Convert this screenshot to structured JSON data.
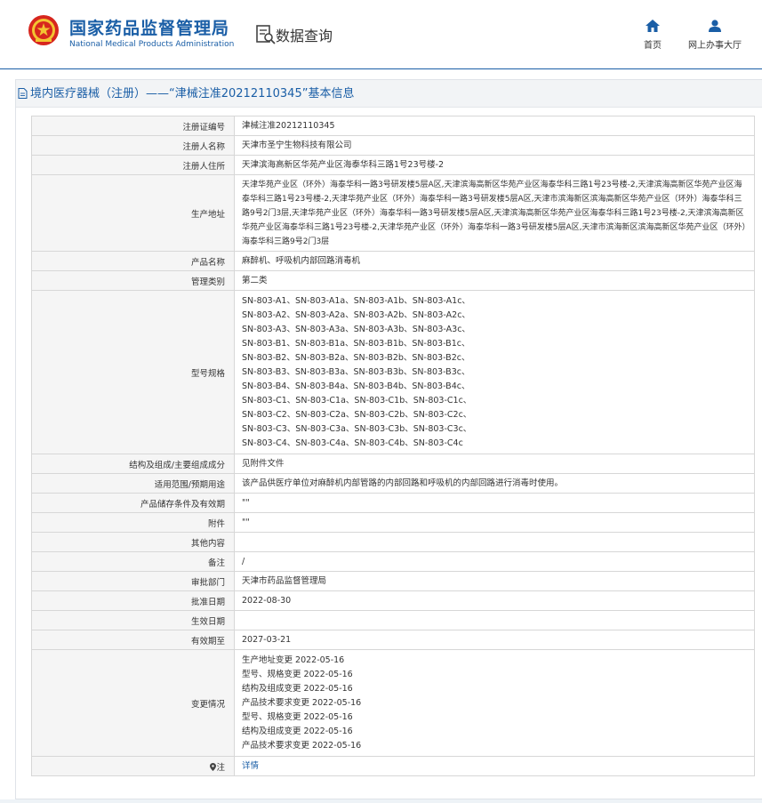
{
  "header": {
    "brand_cn": "国家药品监督管理局",
    "brand_en": "National Medical Products Administration",
    "query_label": "数据查询",
    "nav": [
      {
        "label": "首页",
        "icon": "home-icon"
      },
      {
        "label": "网上办事大厅",
        "icon": "user-icon"
      }
    ]
  },
  "colors": {
    "brand": "#1a5ea6",
    "label_bg": "#f5f5f5",
    "border": "#d7d7d7",
    "title_bg": "#f2f4f6"
  },
  "panel": {
    "title": "境内医疗器械（注册）——“津械注准20212110345”基本信息"
  },
  "record": {
    "reg_no": {
      "label": "注册证编号",
      "value": "津械注准20212110345"
    },
    "registrant": {
      "label": "注册人名称",
      "value": "天津市圣宁生物科技有限公司"
    },
    "registrant_address": {
      "label": "注册人住所",
      "value": "天津滨海高新区华苑产业区海泰华科三路1号23号楼-2"
    },
    "production_address": {
      "label": "生产地址",
      "value": "天津华苑产业区（环外）海泰华科一路3号研发楼5层A区,天津滨海高新区华苑产业区海泰华科三路1号23号楼-2,天津滨海高新区华苑产业区海泰华科三路1号23号楼-2,天津华苑产业区（环外）海泰华科一路3号研发楼5层A区,天津市滨海新区滨海高新区华苑产业区（环外）海泰华科三路9号2门3层,天津华苑产业区（环外）海泰华科一路3号研发楼5层A区,天津滨海高新区华苑产业区海泰华科三路1号23号楼-2,天津滨海高新区华苑产业区海泰华科三路1号23号楼-2,天津华苑产业区（环外）海泰华科一路3号研发楼5层A区,天津市滨海新区滨海高新区华苑产业区（环外）海泰华科三路9号2门3层"
    },
    "product_name": {
      "label": "产品名称",
      "value": "麻醉机、呼吸机内部回路消毒机"
    },
    "category": {
      "label": "管理类别",
      "value": "第二类"
    },
    "models": {
      "label": "型号规格",
      "lines": [
        "SN-803-A1、SN-803-A1a、SN-803-A1b、SN-803-A1c、",
        "SN-803-A2、SN-803-A2a、SN-803-A2b、SN-803-A2c、",
        "SN-803-A3、SN-803-A3a、SN-803-A3b、SN-803-A3c、",
        "SN-803-B1、SN-803-B1a、SN-803-B1b、SN-803-B1c、",
        "SN-803-B2、SN-803-B2a、SN-803-B2b、SN-803-B2c、",
        "SN-803-B3、SN-803-B3a、SN-803-B3b、SN-803-B3c、",
        "SN-803-B4、SN-803-B4a、SN-803-B4b、SN-803-B4c、",
        "SN-803-C1、SN-803-C1a、SN-803-C1b、SN-803-C1c、",
        "SN-803-C2、SN-803-C2a、SN-803-C2b、SN-803-C2c、",
        "SN-803-C3、SN-803-C3a、SN-803-C3b、SN-803-C3c、",
        "SN-803-C4、SN-803-C4a、SN-803-C4b、SN-803-C4c"
      ]
    },
    "structure": {
      "label": "结构及组成/主要组成成分",
      "value": "见附件文件"
    },
    "scope": {
      "label": "适用范围/预期用途",
      "value": "该产品供医疗单位对麻醉机内部管路的内部回路和呼吸机的内部回路进行消毒时使用。"
    },
    "storage": {
      "label": "产品储存条件及有效期",
      "value": "\"\""
    },
    "attachment": {
      "label": "附件",
      "value": "\"\""
    },
    "other": {
      "label": "其他内容",
      "value": ""
    },
    "remark": {
      "label": "备注",
      "value": "/"
    },
    "approval_dept": {
      "label": "审批部门",
      "value": "天津市药品监督管理局"
    },
    "approval_date": {
      "label": "批准日期",
      "value": "2022-08-30"
    },
    "effective_date": {
      "label": "生效日期",
      "value": ""
    },
    "valid_until": {
      "label": "有效期至",
      "value": "2027-03-21"
    },
    "changes": {
      "label": "变更情况",
      "lines": [
        "生产地址变更 2022-05-16",
        "型号、规格变更 2022-05-16",
        "结构及组成变更 2022-05-16",
        "产品技术要求变更 2022-05-16",
        "型号、规格变更 2022-05-16",
        "结构及组成变更 2022-05-16",
        "产品技术要求变更 2022-05-16"
      ]
    },
    "note": {
      "label": "注",
      "icon": "location-pin-icon",
      "link": "详情"
    }
  }
}
